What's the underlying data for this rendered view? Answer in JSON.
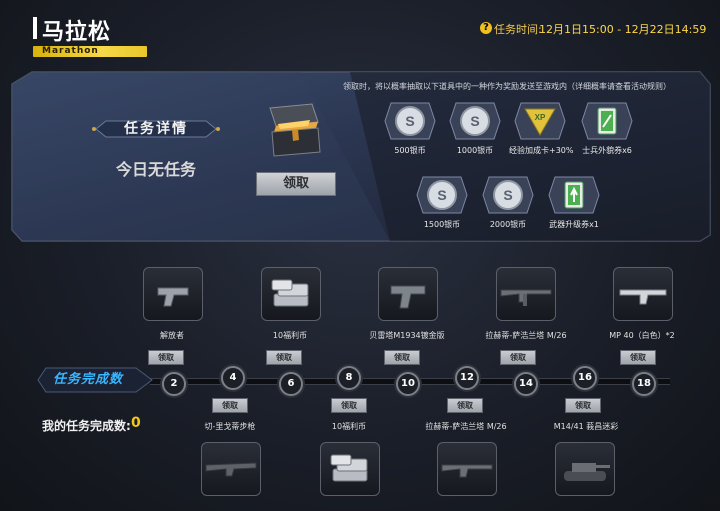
{
  "header": {
    "title": "马拉松",
    "subtitle": "Marathon",
    "time_label": "任务时间:",
    "time_value": "12月1日15:00 - 12月22日14:59",
    "help_icon": "?"
  },
  "panel": {
    "detail_label": "任务详情",
    "no_task": "今日无任务",
    "claim_label": "领取",
    "reward_note": "领取时，将以概率抽取以下道具中的一种作为奖励发送至游戏内（详细概率请查看活动规则）",
    "rewards": [
      {
        "label": "500银币",
        "icon": "silver-coin-icon"
      },
      {
        "label": "1000银币",
        "icon": "silver-coin-icon"
      },
      {
        "label": "经验加成卡+30%",
        "icon": "xp-card-icon"
      },
      {
        "label": "士兵外貌券x6",
        "icon": "ticket-icon"
      },
      {
        "label": "1500银币",
        "icon": "silver-coin-icon"
      },
      {
        "label": "2000银币",
        "icon": "silver-coin-icon"
      },
      {
        "label": "武器升级券x1",
        "icon": "ticket-icon"
      }
    ]
  },
  "progress": {
    "label": "任务完成数",
    "my_count_label": "我的任务完成数:",
    "my_count_value": "0",
    "claim_label": "领取",
    "nodes": [
      "2",
      "4",
      "6",
      "8",
      "10",
      "12",
      "14",
      "16",
      "18"
    ],
    "top_rewards": [
      {
        "name": "解放者",
        "icon": "pistol-icon"
      },
      {
        "name": "10福利币",
        "icon": "coin-stack-icon"
      },
      {
        "name": "贝雷塔M1934镀金版",
        "icon": "pistol-icon"
      },
      {
        "name": "拉赫蒂-萨浩兰塔 M/26",
        "icon": "rifle-icon"
      },
      {
        "name": "MP 40（白色）*2",
        "icon": "smg-icon"
      }
    ],
    "bottom_rewards": [
      {
        "name": "切-里戈蒂步枪",
        "icon": "rifle-icon"
      },
      {
        "name": "10福利币",
        "icon": "coin-stack-icon"
      },
      {
        "name": "拉赫蒂-萨浩兰塔 M/26",
        "icon": "rifle-icon"
      },
      {
        "name": "M14/41 莪昌迷彩",
        "icon": "tank-icon"
      }
    ]
  }
}
